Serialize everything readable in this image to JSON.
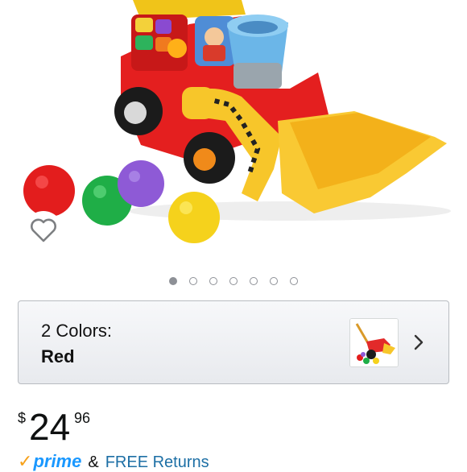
{
  "carousel": {
    "image_alt": "",
    "dots_total": 7,
    "active_index": 0
  },
  "favorite": {
    "icon": "heart-outline-icon"
  },
  "variant": {
    "label": "2 Colors:",
    "value": "Red",
    "chevron_icon": "chevron-right-icon"
  },
  "price": {
    "currency": "$",
    "whole": "24",
    "fraction": "96"
  },
  "shipping": {
    "check": "✓",
    "prime": "prime",
    "ampersand": "&",
    "returns": "FREE Returns"
  },
  "colors": {
    "prime_blue": "#1a98ff",
    "prime_check": "#f7a11a",
    "link_blue": "#1d6fa5",
    "dot_gray": "#8d9096"
  }
}
